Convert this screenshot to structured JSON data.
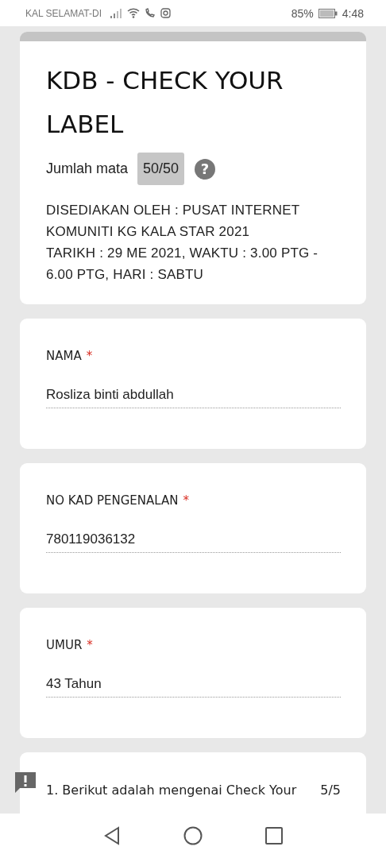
{
  "status_bar": {
    "carrier": "KAL SELAMAT-DI",
    "battery": "85%",
    "time": "4:48"
  },
  "header": {
    "title": "KDB - CHECK YOUR LABEL",
    "score_label": "Jumlah mata",
    "score": "50/50",
    "help": "?",
    "description": [
      "DISEDIAKAN OLEH : PUSAT INTERNET KOMUNITI KG KALA STAR 2021",
      "TARIKH : 29 ME 2021, WAKTU : 3.00 PTG - 6.00 PTG, HARI : SABTU"
    ]
  },
  "fields": [
    {
      "label": "NAMA",
      "required_mark": "*",
      "value": "Rosliza binti abdullah"
    },
    {
      "label": "NO KAD PENGENALAN",
      "required_mark": "*",
      "value": "780119036132"
    },
    {
      "label": "UMUR",
      "required_mark": "*",
      "value": "43 Tahun"
    }
  ],
  "question": {
    "text": "1. Berikut adalah mengenai Check Your",
    "score": "5/5",
    "flagged": true
  }
}
